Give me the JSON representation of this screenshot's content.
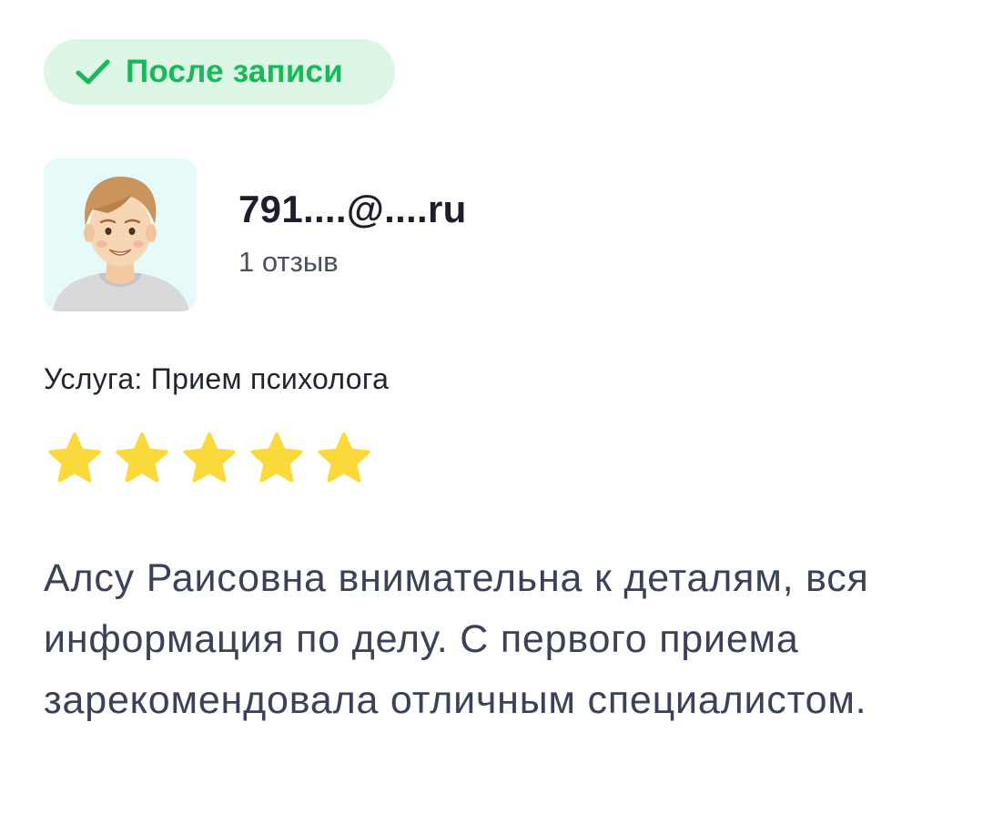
{
  "badge": {
    "label": "После записи",
    "icon": "check-icon",
    "color": "#19b95a",
    "background": "#dcf7e6"
  },
  "author": {
    "name": "791....@....ru",
    "review_count": "1 отзыв",
    "avatar_icon": "user-avatar"
  },
  "service": {
    "text": "Услуга: Прием психолога"
  },
  "rating": {
    "stars": 5,
    "max": 5,
    "color": "#fcd93a"
  },
  "review": {
    "text": "Алсу Раисовна внимательна к деталям, вся информация по делу. С первого приема зарекомендовала отличным специалистом."
  }
}
